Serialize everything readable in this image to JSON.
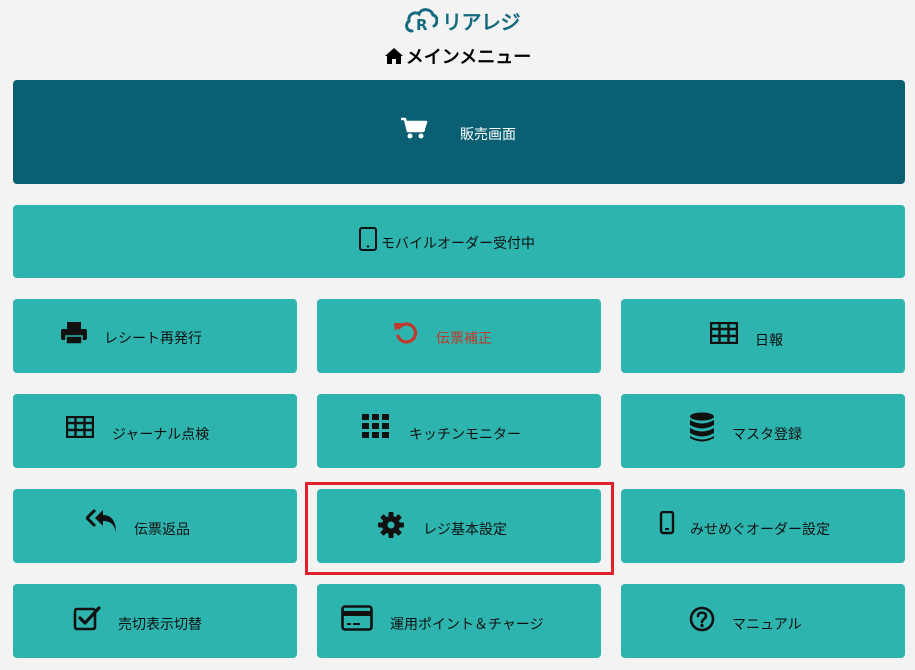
{
  "header": {
    "logo_text": "リアレジ",
    "title": "メインメニュー"
  },
  "menu": {
    "sales": "販売画面",
    "mobile_order": "モバイルオーダー受付中",
    "receipt_reissue": "レシート再発行",
    "slip_correction": "伝票補正",
    "daily_report": "日報",
    "journal_check": "ジャーナル点検",
    "kitchen_monitor": "キッチンモニター",
    "master_register": "マスタ登録",
    "slip_return": "伝票返品",
    "register_settings": "レジ基本設定",
    "misemegu_order_settings": "みせめぐオーダー設定",
    "soldout_toggle": "売切表示切替",
    "points_charge": "運用ポイント＆チャージ",
    "manual": "マニュアル"
  },
  "colors": {
    "primary_dark": "#0b5f72",
    "primary": "#2eb4ae",
    "highlight": "#e0202a",
    "warn_text": "#c0392b"
  }
}
